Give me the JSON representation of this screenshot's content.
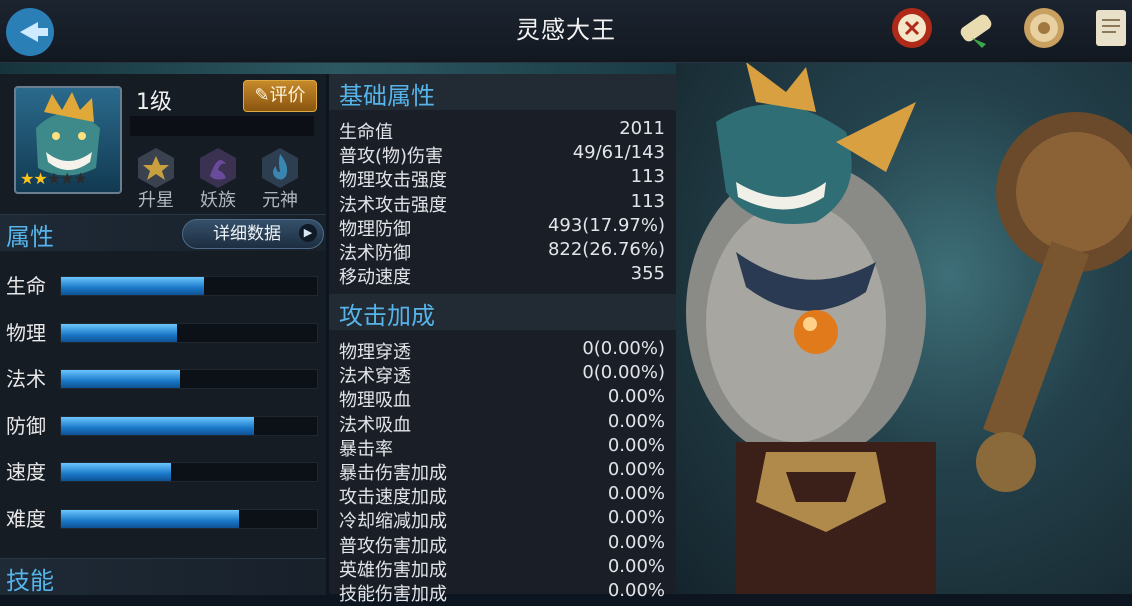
{
  "header": {
    "title": "灵感大王"
  },
  "hero": {
    "level": "1级",
    "evaluate_label": "评价",
    "stars_filled": 2,
    "stars_total": 5,
    "badges": [
      {
        "label": "升星",
        "icon": "star-badge-icon"
      },
      {
        "label": "妖族",
        "icon": "demon-clan-icon"
      },
      {
        "label": "元神",
        "icon": "spirit-flame-icon"
      }
    ]
  },
  "attributes": {
    "title": "属性",
    "detail_label": "详细数据",
    "stats": [
      {
        "label": "生命",
        "fraction": 0.56
      },
      {
        "label": "物理",
        "fraction": 0.455
      },
      {
        "label": "法术",
        "fraction": 0.465
      },
      {
        "label": "防御",
        "fraction": 0.755
      },
      {
        "label": "速度",
        "fraction": 0.43
      },
      {
        "label": "难度",
        "fraction": 0.695
      }
    ]
  },
  "skills": {
    "title": "技能"
  },
  "base_stats": {
    "title": "基础属性",
    "rows": [
      {
        "k": "生命值",
        "v": "2011"
      },
      {
        "k": "普攻(物)伤害",
        "v": "49/61/143"
      },
      {
        "k": "物理攻击强度",
        "v": "113"
      },
      {
        "k": "法术攻击强度",
        "v": "113"
      },
      {
        "k": "物理防御",
        "v": "493(17.97%)"
      },
      {
        "k": "法术防御",
        "v": "822(26.76%)"
      },
      {
        "k": "移动速度",
        "v": "355"
      }
    ]
  },
  "attack_bonus": {
    "title": "攻击加成",
    "rows": [
      {
        "k": "物理穿透",
        "v": "0(0.00%)"
      },
      {
        "k": "法术穿透",
        "v": "0(0.00%)"
      },
      {
        "k": "物理吸血",
        "v": "0.00%"
      },
      {
        "k": "法术吸血",
        "v": "0.00%"
      },
      {
        "k": "暴击率",
        "v": "0.00%"
      },
      {
        "k": "暴击伤害加成",
        "v": "0.00%"
      },
      {
        "k": "攻击速度加成",
        "v": "0.00%"
      },
      {
        "k": "冷却缩减加成",
        "v": "0.00%"
      },
      {
        "k": "普攻伤害加成",
        "v": "0.00%"
      },
      {
        "k": "英雄伤害加成",
        "v": "0.00%"
      },
      {
        "k": "技能伤害加成",
        "v": "0.00%"
      }
    ]
  },
  "top_icons": [
    "trial-seal-icon",
    "scroll-icon",
    "coin-medal-icon",
    "document-icon"
  ],
  "colors": {
    "accent": "#56b4ea",
    "bar_fill": "#1a78c8",
    "eval_button": "#c68a2a"
  }
}
